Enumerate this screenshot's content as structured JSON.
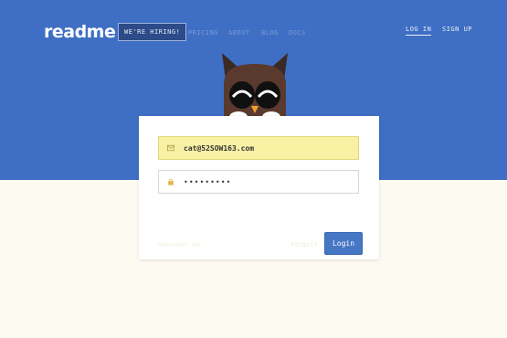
{
  "header": {
    "logo": "readme",
    "nav": [
      "WE'RE HIRING!",
      "PRICING",
      "ABOUT",
      "BLOG",
      "DOCS"
    ],
    "login_label": "LOG IN",
    "signup_label": "SIGN UP"
  },
  "form": {
    "email_value": "cat@52SOW163.com",
    "password_value": "•••••••••",
    "remember_label": "Remember me",
    "forgot_label": "Forgot?",
    "login_button": "Login"
  },
  "colors": {
    "hero": "#3f6fc4",
    "button": "#4577c4",
    "autofill": "#f8f0a3"
  },
  "icons": {
    "email": "envelope-icon",
    "password": "lock-icon"
  }
}
